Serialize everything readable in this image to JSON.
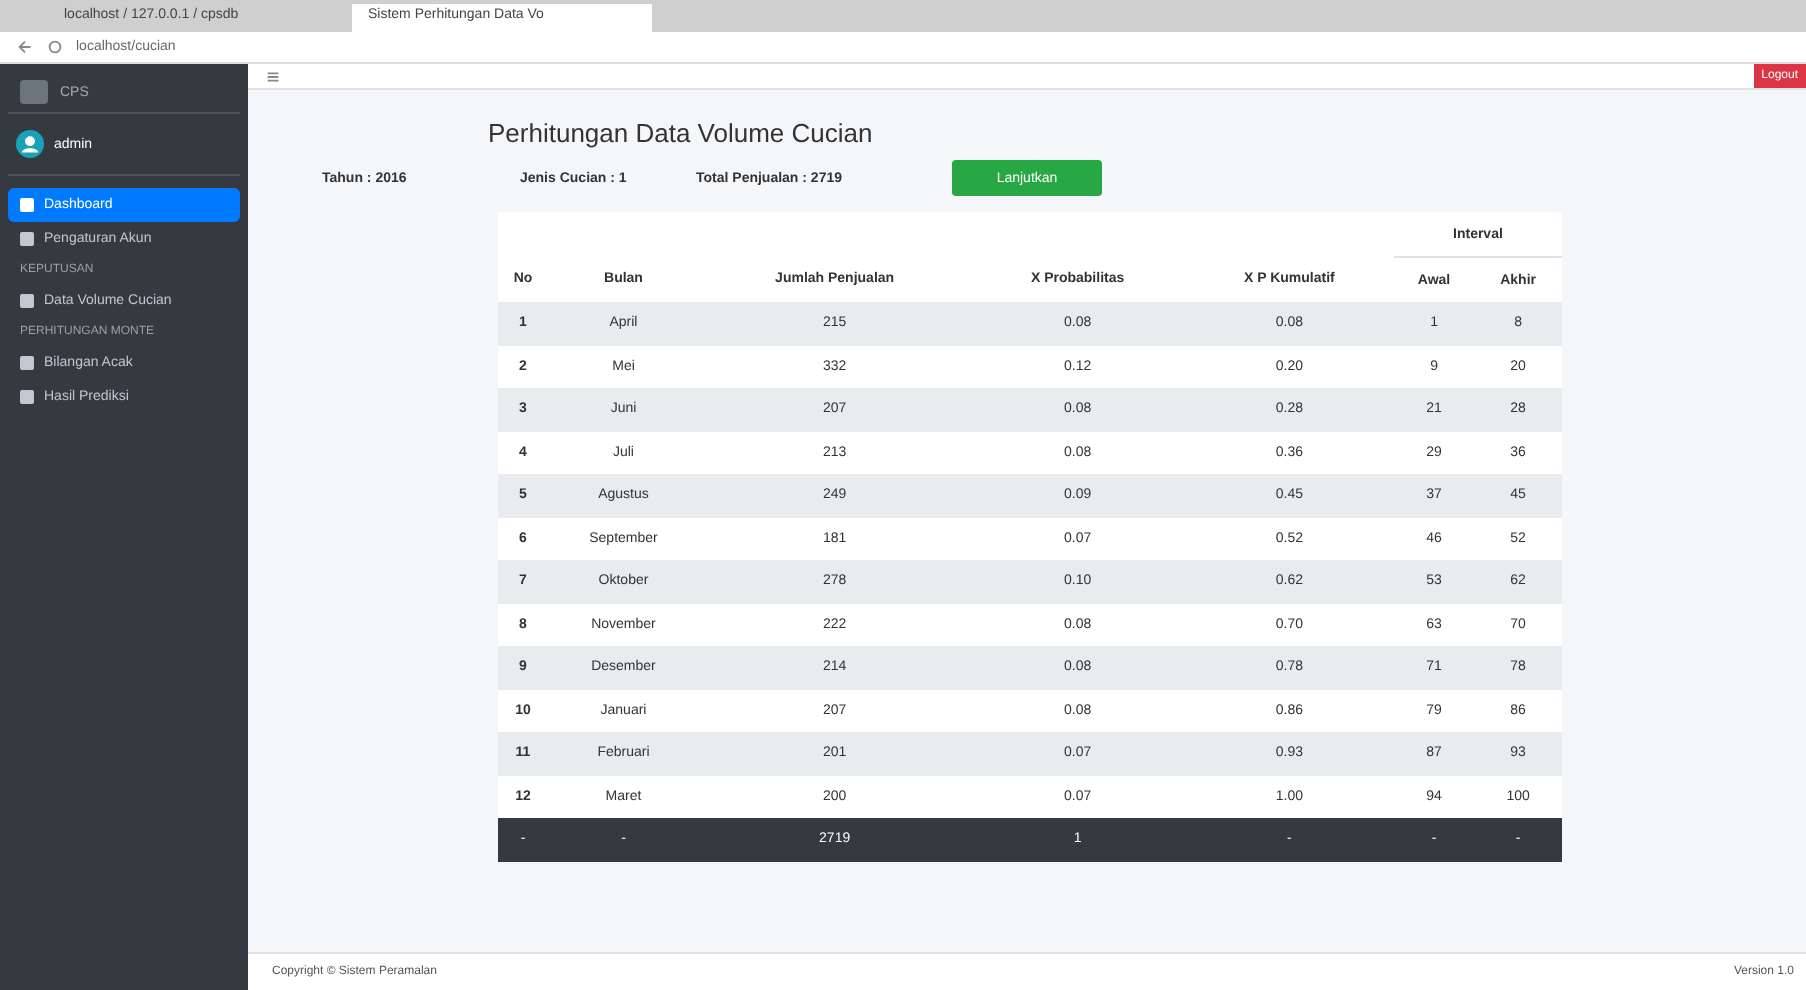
{
  "browser": {
    "tabs": [
      {
        "title": "localhost / 127.0.0.1 / cpsdb",
        "selected": false
      },
      {
        "title": "Sistem Perhitungan Data Vo",
        "selected": true
      }
    ],
    "address": "localhost/cucian"
  },
  "sidebar": {
    "brand": "CPS",
    "user": "admin",
    "items": [
      {
        "kind": "item",
        "label": "Dashboard",
        "selected": true
      },
      {
        "kind": "item",
        "label": "Pengaturan Akun",
        "selected": false
      },
      {
        "kind": "header",
        "label": "KEPUTUSAN"
      },
      {
        "kind": "item",
        "label": "Data Volume Cucian",
        "selected": false
      },
      {
        "kind": "header",
        "label": "PERHITUNGAN MONTE"
      },
      {
        "kind": "item",
        "label": "Bilangan Acak",
        "selected": false
      },
      {
        "kind": "item",
        "label": "Hasil Prediksi",
        "selected": false
      }
    ]
  },
  "topbar": {
    "logout": "Logout"
  },
  "page": {
    "title": "Perhitungan Data Volume Cucian",
    "tahun": "Tahun : 2016",
    "jenis": "Jenis Cucian : 1",
    "total": "Total Penjualan : 2719",
    "button": "Lanjutkan"
  },
  "table": {
    "group_header": "Interval",
    "columns": [
      "No",
      "Bulan",
      "Jumlah Penjualan",
      "X Probabilitas",
      "X P Kumulatif",
      "Awal",
      "Akhir"
    ],
    "rows": [
      [
        "1",
        "April",
        "215",
        "0.08",
        "0.08",
        "1",
        "8"
      ],
      [
        "2",
        "Mei",
        "332",
        "0.12",
        "0.20",
        "9",
        "20"
      ],
      [
        "3",
        "Juni",
        "207",
        "0.08",
        "0.28",
        "21",
        "28"
      ],
      [
        "4",
        "Juli",
        "213",
        "0.08",
        "0.36",
        "29",
        "36"
      ],
      [
        "5",
        "Agustus",
        "249",
        "0.09",
        "0.45",
        "37",
        "45"
      ],
      [
        "6",
        "September",
        "181",
        "0.07",
        "0.52",
        "46",
        "52"
      ],
      [
        "7",
        "Oktober",
        "278",
        "0.10",
        "0.62",
        "53",
        "62"
      ],
      [
        "8",
        "November",
        "222",
        "0.08",
        "0.70",
        "63",
        "70"
      ],
      [
        "9",
        "Desember",
        "214",
        "0.08",
        "0.78",
        "71",
        "78"
      ],
      [
        "10",
        "Januari",
        "207",
        "0.08",
        "0.86",
        "79",
        "86"
      ],
      [
        "11",
        "Februari",
        "201",
        "0.07",
        "0.93",
        "87",
        "93"
      ],
      [
        "12",
        "Maret",
        "200",
        "0.07",
        "1.00",
        "94",
        "100"
      ]
    ],
    "footer": [
      "-",
      "-",
      "2719",
      "1",
      "-",
      "-",
      "-"
    ]
  },
  "footer": {
    "copyright": "Copyright © Sistem Peramalan",
    "version": "Version 1.0"
  }
}
